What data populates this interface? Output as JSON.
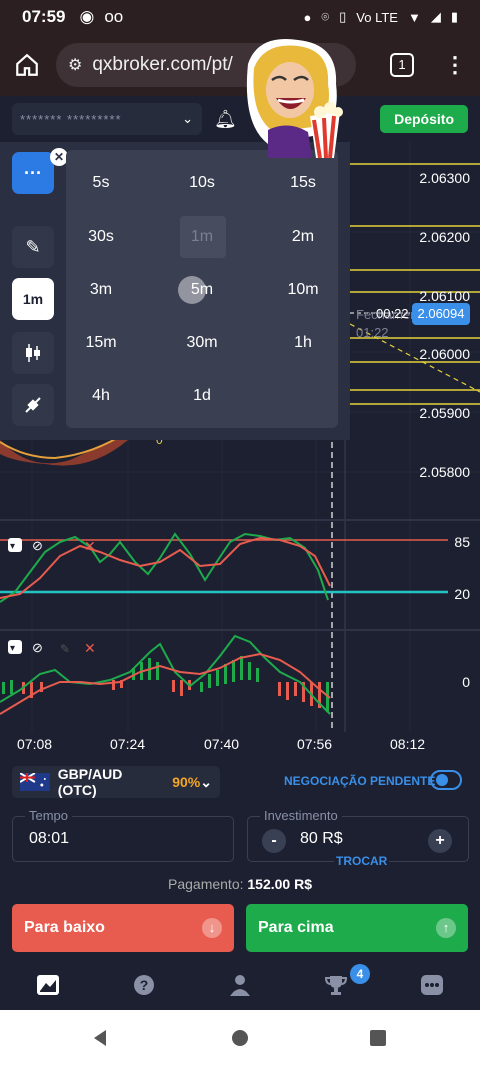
{
  "status": {
    "time": "07:59",
    "network": "Vo LTE"
  },
  "browser": {
    "url": "qxbroker.com/pt/",
    "tabs": "1"
  },
  "header": {
    "account": "******* *********",
    "deposit": "Depósito"
  },
  "chart": {
    "y_labels": [
      "2.06300",
      "2.06200",
      "2.06100",
      "2.06000",
      "2.05900",
      "2.05800"
    ],
    "price": "2.06094",
    "timer": "00:22",
    "closing_label": "Fechamento",
    "closing_time": "01:22",
    "rsi_levels": [
      "85",
      "20"
    ],
    "macd_zero": "0",
    "time_labels": [
      "07:08",
      "07:24",
      "07:40",
      "07:56",
      "08:12"
    ]
  },
  "tools": {
    "timeframe": "1m",
    "options": [
      "5s",
      "10s",
      "15s",
      "30s",
      "1m",
      "2m",
      "3m",
      "5m",
      "10m",
      "15m",
      "30m",
      "1h",
      "4h",
      "1d"
    ]
  },
  "trade": {
    "pair": "GBP/AUD (OTC)",
    "payout": "90%",
    "pending": "NEGOCIAÇÃO PENDENTE",
    "time_label": "Tempo",
    "time_value": "08:01",
    "invest_label": "Investimento",
    "invest_value": "80 R$",
    "switch": "TROCAR",
    "payment_label": "Pagamento:",
    "payment_value": "152.00 R$",
    "down": "Para baixo",
    "up": "Para cima"
  },
  "nav": {
    "badge": "4"
  }
}
